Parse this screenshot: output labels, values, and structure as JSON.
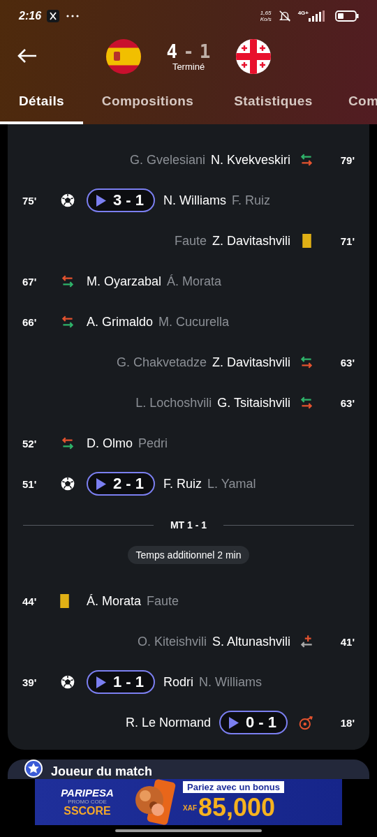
{
  "status_bar": {
    "time": "2:16",
    "speed": "1,65",
    "speed_unit": "Ko/s",
    "network": "4G+"
  },
  "header": {
    "score_home": "4",
    "score_sep": "-",
    "score_away": "1",
    "status": "Terminé"
  },
  "tabs": [
    {
      "label": "Détails",
      "selected": true
    },
    {
      "label": "Compositions",
      "selected": false
    },
    {
      "label": "Statistiques",
      "selected": false
    },
    {
      "label": "Com",
      "selected": false
    }
  ],
  "events": [
    {
      "kind": "substitution",
      "home_team": false,
      "minute": "79'",
      "main": "N. Kvekveskiri",
      "secondary": "G. Gvelesiani"
    },
    {
      "kind": "goal",
      "home_team": true,
      "minute": "75'",
      "score": "3 - 1",
      "main": "N. Williams",
      "secondary": "F. Ruiz"
    },
    {
      "kind": "yellow_card",
      "home_team": false,
      "minute": "71'",
      "main": "Z. Davitashvili",
      "secondary": "Faute"
    },
    {
      "kind": "substitution",
      "home_team": true,
      "minute": "67'",
      "main": "M. Oyarzabal",
      "secondary": "Á. Morata"
    },
    {
      "kind": "substitution",
      "home_team": true,
      "minute": "66'",
      "main": "A. Grimaldo",
      "secondary": "M. Cucurella"
    },
    {
      "kind": "substitution",
      "home_team": false,
      "minute": "63'",
      "main": "Z. Davitashvili",
      "secondary": "G. Chakvetadze"
    },
    {
      "kind": "substitution",
      "home_team": false,
      "minute": "63'",
      "main": "G. Tsitaishvili",
      "secondary": "L. Lochoshvili"
    },
    {
      "kind": "substitution",
      "home_team": true,
      "minute": "52'",
      "main": "D. Olmo",
      "secondary": "Pedri"
    },
    {
      "kind": "goal",
      "home_team": true,
      "minute": "51'",
      "score": "2 - 1",
      "main": "F. Ruiz",
      "secondary": "L. Yamal"
    },
    {
      "kind": "period",
      "label": "MT 1 - 1"
    },
    {
      "kind": "added_time",
      "label": "Temps additionnel 2 min"
    },
    {
      "kind": "yellow_card",
      "home_team": true,
      "minute": "44'",
      "main": "Á. Morata",
      "secondary": "Faute"
    },
    {
      "kind": "injury_substitution",
      "home_team": false,
      "minute": "41'",
      "main": "S. Altunashvili",
      "secondary": "O. Kiteishvili"
    },
    {
      "kind": "goal",
      "home_team": true,
      "minute": "39'",
      "score": "1 - 1",
      "main": "Rodri",
      "secondary": "N. Williams"
    },
    {
      "kind": "own_goal",
      "home_team": false,
      "minute": "18'",
      "score": "0 - 1",
      "main": "R. Le Normand"
    }
  ],
  "next_card": {
    "title": "Joueur du match"
  },
  "ad": {
    "brand": "PARIPESA",
    "promo_label": "PROMO CODE",
    "promo_code": "SSCORE",
    "headline": "Pariez avec un bonus",
    "currency": "XAF",
    "amount": "85,000"
  }
}
